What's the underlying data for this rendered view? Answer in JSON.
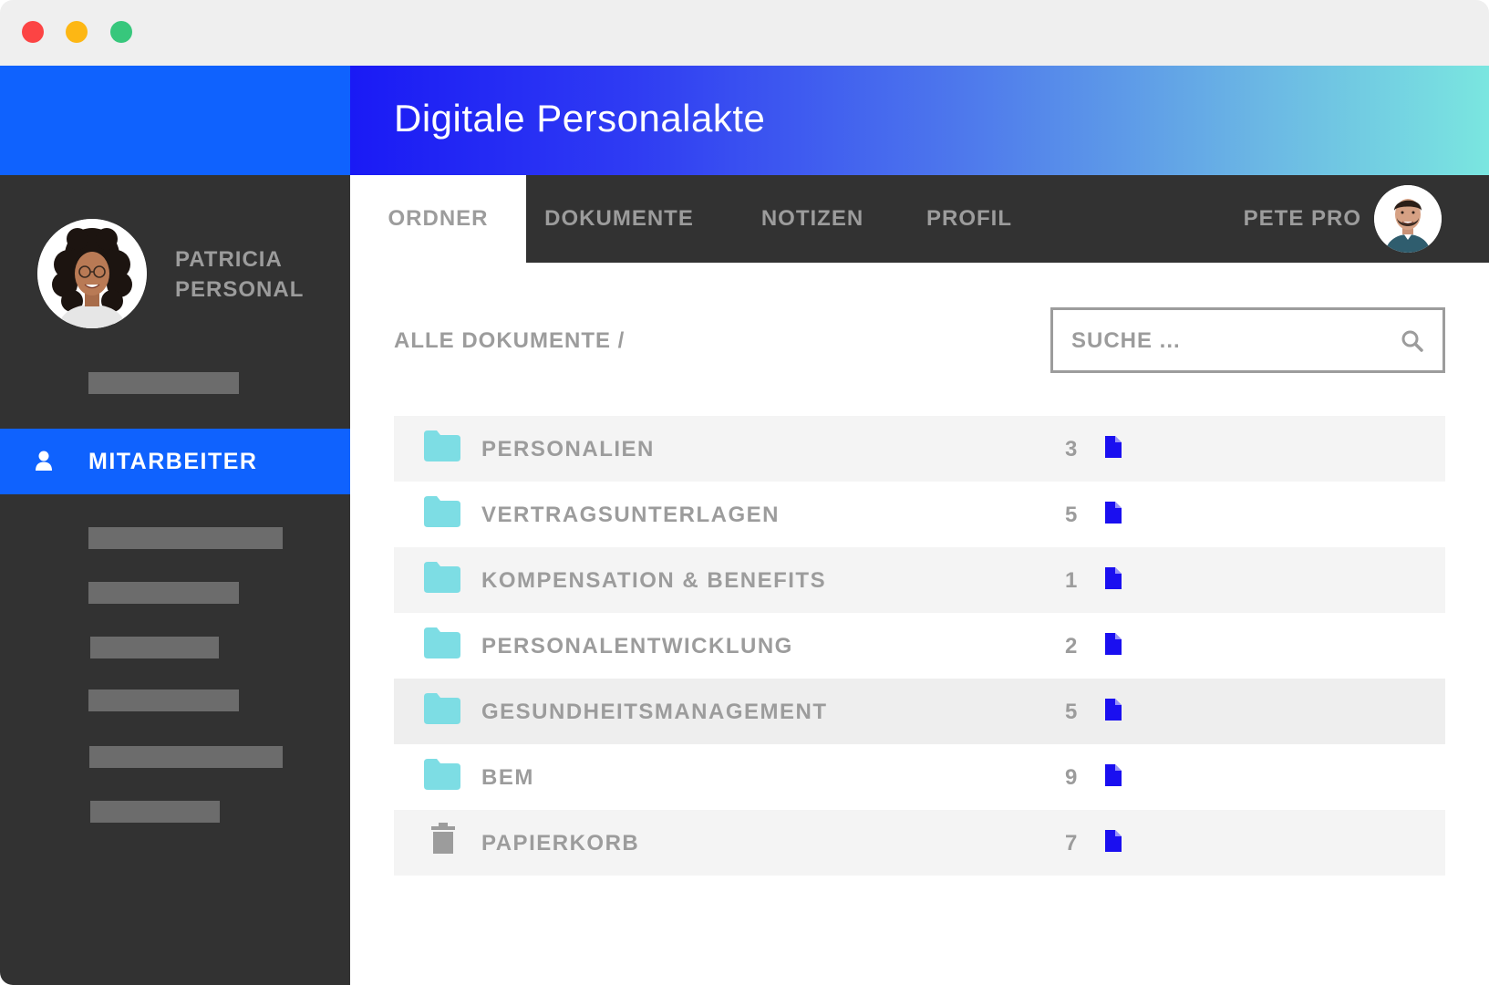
{
  "window": {
    "controls": [
      "close",
      "minimize",
      "maximize"
    ]
  },
  "header": {
    "title": "Digitale Personalakte"
  },
  "sidebar": {
    "user": {
      "first_name": "PATRICIA",
      "last_name": "PERSONAL",
      "avatar_icon": "avatar-woman"
    },
    "active_item": {
      "label": "MITARBEITER",
      "icon": "person-icon"
    },
    "accent_color": "#0f62fe"
  },
  "tabs": [
    {
      "label": "ORDNER",
      "active": true
    },
    {
      "label": "DOKUMENTE",
      "active": false
    },
    {
      "label": "NOTIZEN",
      "active": false
    },
    {
      "label": "PROFIL",
      "active": false
    }
  ],
  "current_user": {
    "name": "PETE PRO",
    "avatar_icon": "avatar-man"
  },
  "breadcrumb": "ALLE DOKUMENTE /",
  "search": {
    "placeholder": "SUCHE ...",
    "value": ""
  },
  "folders": [
    {
      "name": "PERSONALIEN",
      "count": "3",
      "icon": "folder-icon"
    },
    {
      "name": "VERTRAGSUNTERLAGEN",
      "count": "5",
      "icon": "folder-icon"
    },
    {
      "name": "KOMPENSATION & BENEFITS",
      "count": "1",
      "icon": "folder-icon"
    },
    {
      "name": "PERSONALENTWICKLUNG",
      "count": "2",
      "icon": "folder-icon"
    },
    {
      "name": "GESUNDHEITSMANAGEMENT",
      "count": "5",
      "icon": "folder-icon"
    },
    {
      "name": "BEM",
      "count": "9",
      "icon": "folder-icon"
    },
    {
      "name": "PAPIERKORB",
      "count": "7",
      "icon": "trash-icon"
    }
  ],
  "colors": {
    "folder": "#7ddde4",
    "document": "#1a0ff0",
    "text_muted": "#9c9c9c",
    "dark": "#323232"
  }
}
